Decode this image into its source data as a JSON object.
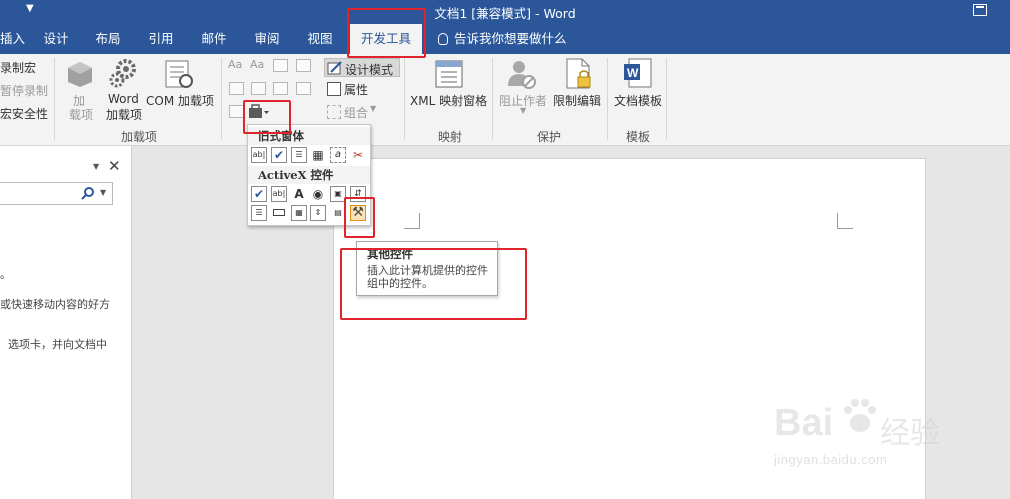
{
  "title_bar": {
    "title": "文档1 [兼容模式] - Word"
  },
  "tabs": [
    {
      "label": "插入",
      "active": false
    },
    {
      "label": "设计",
      "active": false
    },
    {
      "label": "布局",
      "active": false
    },
    {
      "label": "引用",
      "active": false
    },
    {
      "label": "邮件",
      "active": false
    },
    {
      "label": "审阅",
      "active": false
    },
    {
      "label": "视图",
      "active": false
    },
    {
      "label": "开发工具",
      "active": true
    }
  ],
  "tell_me": {
    "text": "告诉我你想要做什么"
  },
  "ribbon": {
    "code_group": {
      "record_macro": "录制宏",
      "pause_record": "暂停录制",
      "macro_security": "宏安全性"
    },
    "addins_group": {
      "label": "加载项",
      "addins_line1": "加",
      "addins_line2": "载项",
      "word_addins_line1": "Word",
      "word_addins_line2": "加载项",
      "com_addins": "COM 加载项"
    },
    "controls_group": {
      "design_mode": "设计模式",
      "properties": "属性",
      "group": "组合"
    },
    "mapping_group": {
      "label": "映射",
      "xml_pane": "XML 映射窗格"
    },
    "protect_group": {
      "label": "保护",
      "block_authors": "阻止作者",
      "restrict_editing": "限制编辑"
    },
    "templates_group": {
      "label": "模板",
      "document_template": "文档模板"
    }
  },
  "dropdown": {
    "legacy_forms_heading": "旧式窗体",
    "activex_heading": "ActiveX 控件",
    "icon_text_ab": "ab|",
    "icon_text_a": "A"
  },
  "tooltip": {
    "title": "其他控件",
    "description": "插入此计算机提供的控件组中的控件。"
  },
  "nav_pane": {
    "text1": "。",
    "text2": "或快速移动内容的好方",
    "text3": "选项卡，并向文档中"
  },
  "watermark": {
    "brand": "Bai",
    "brand_cn": "经验",
    "url": "jingyan.baidu.com"
  },
  "colors": {
    "word_blue": "#2b579a",
    "annotation_red": "#e0242b",
    "ribbon_bg": "#f3f3f3"
  }
}
